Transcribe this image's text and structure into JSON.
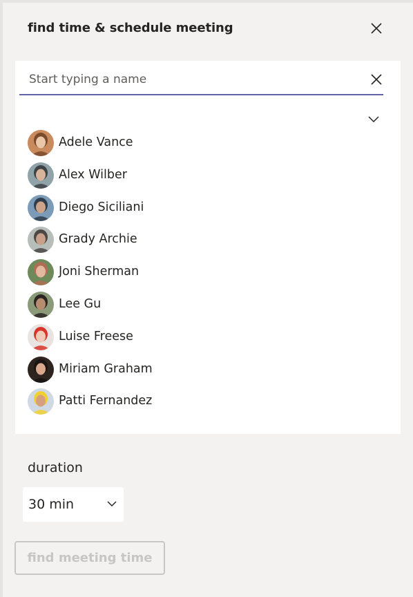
{
  "header": {
    "title": "find time & schedule meeting"
  },
  "search": {
    "placeholder": "Start typing a name"
  },
  "people": [
    {
      "name": "Adele Vance",
      "avatar_colors": [
        "#c98a5e",
        "#7a4a2c",
        "#e9c7a8"
      ]
    },
    {
      "name": "Alex Wilber",
      "avatar_colors": [
        "#8fa3a8",
        "#3d4346",
        "#d8b49a"
      ]
    },
    {
      "name": "Diego Siciliani",
      "avatar_colors": [
        "#7b9bb8",
        "#2f3d4a",
        "#cda38a"
      ]
    },
    {
      "name": "Grady Archie",
      "avatar_colors": [
        "#b7bdb8",
        "#4a4744",
        "#c9a08a"
      ]
    },
    {
      "name": "Joni Sherman",
      "avatar_colors": [
        "#6f8a5a",
        "#b06d54",
        "#e3b8a0"
      ]
    },
    {
      "name": "Lee Gu",
      "avatar_colors": [
        "#8b9b7a",
        "#2b2624",
        "#b88c6e"
      ]
    },
    {
      "name": "Luise Freese",
      "avatar_colors": [
        "#e9e4e2",
        "#d8342a",
        "#f0c9b8"
      ]
    },
    {
      "name": "Miriam Graham",
      "avatar_colors": [
        "#2d241f",
        "#1a1412",
        "#d9a88d"
      ]
    },
    {
      "name": "Patti Fernandez",
      "avatar_colors": [
        "#cfd9e4",
        "#f2d032",
        "#d6a07f"
      ]
    }
  ],
  "duration": {
    "label": "duration",
    "value": "30 min"
  },
  "actions": {
    "find_label": "find meeting time"
  },
  "theme": {
    "accent": "#6264a7",
    "panel_bg": "#f3f2f1",
    "disabled": "#c8c6c4"
  }
}
